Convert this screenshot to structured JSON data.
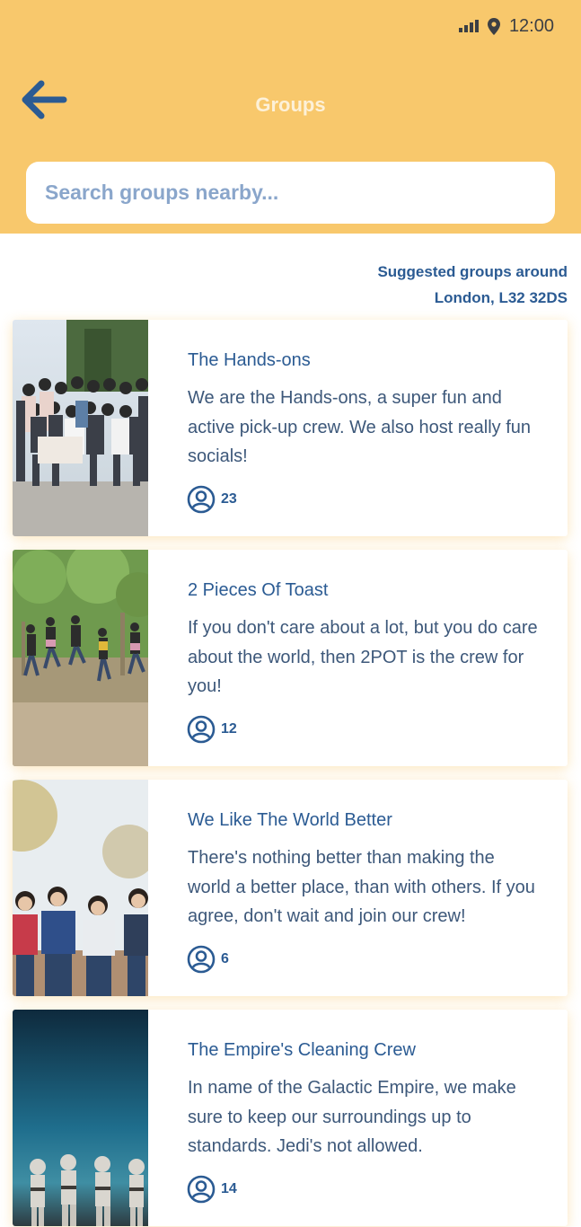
{
  "status_bar": {
    "time": "12:00",
    "icons": [
      "signal-icon",
      "location-pin-icon"
    ]
  },
  "header": {
    "title": "Groups",
    "back_icon": "arrow-left-icon",
    "search": {
      "placeholder": "Search groups nearby...",
      "value": ""
    }
  },
  "suggested": {
    "line1": "Suggested groups around",
    "line2": "London, L32 32DS"
  },
  "groups": [
    {
      "name": "The Hands-ons",
      "description": "We are the Hands-ons, a super fun and active pick-up crew. We also host really fun socials!",
      "members": "23",
      "photo": "group-photo"
    },
    {
      "name": "2 Pieces Of Toast",
      "description": "If you don't care about a lot, but you do care about the world, then 2POT is the crew for you!",
      "members": "12",
      "photo": "jumping-photo"
    },
    {
      "name": "We Like The World Better",
      "description": "There's nothing better than making the world a better place, than with others. If you agree, don't wait and join our crew!",
      "members": "6",
      "photo": "friends-photo"
    },
    {
      "name": "The Empire's Cleaning Crew",
      "description": "In name of the Galactic Empire, we make sure to keep our surroundings up to standards. Jedi's not allowed.",
      "members": "14",
      "photo": "stormtroopers-photo"
    }
  ],
  "colors": {
    "header_bg": "#f8c86c",
    "primary_blue": "#2b5b93",
    "text_blue": "#3d587a",
    "placeholder": "#8aa6cb"
  }
}
